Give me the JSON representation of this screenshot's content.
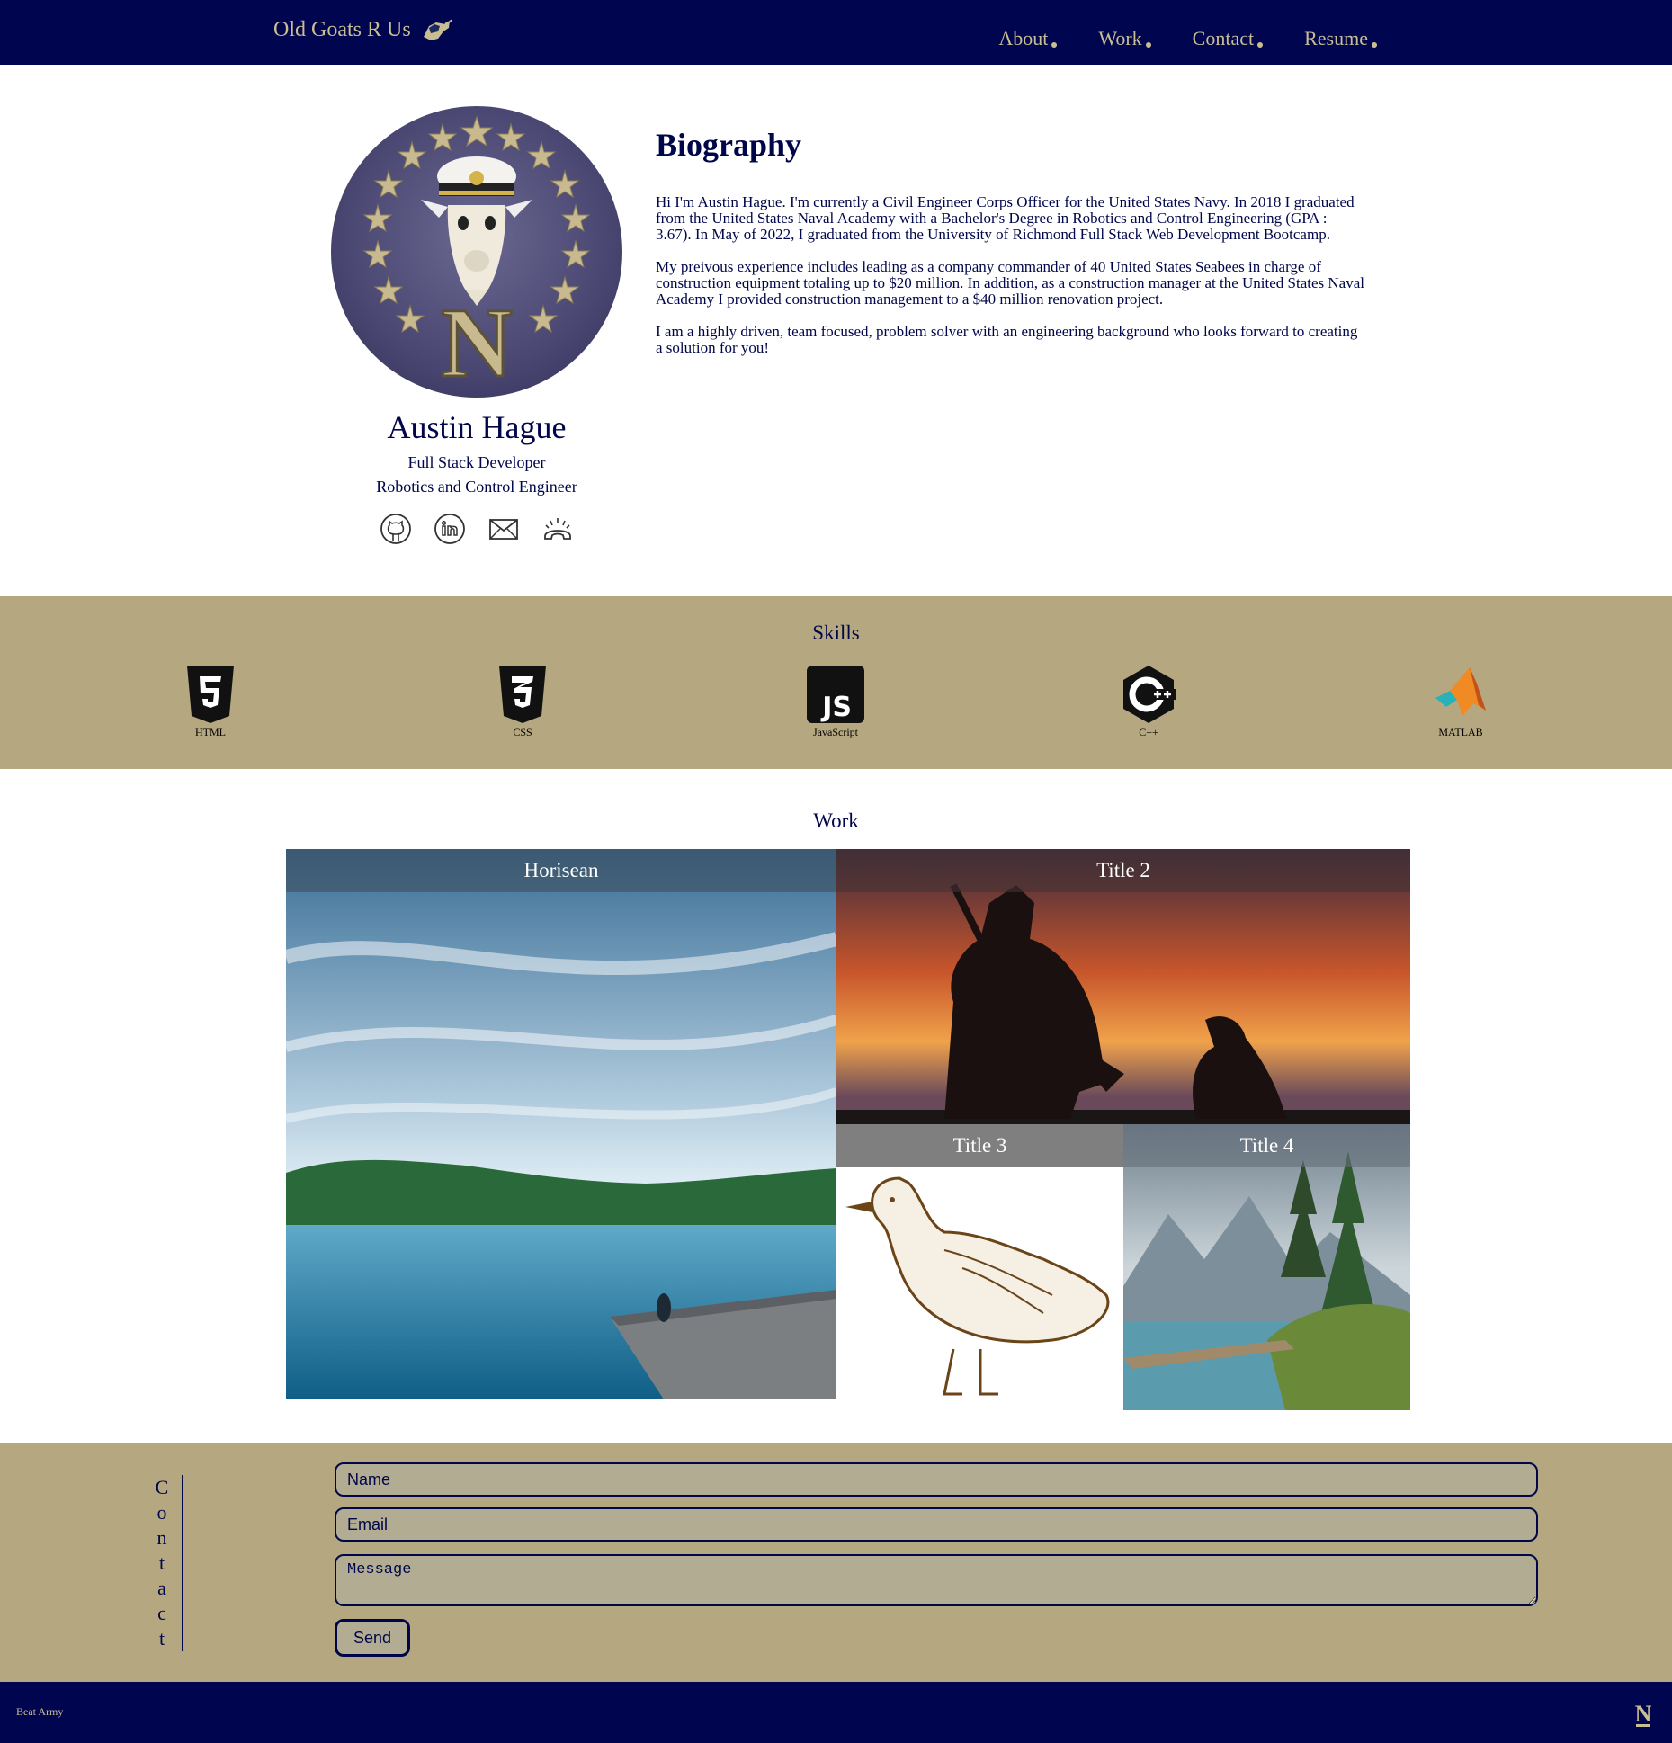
{
  "header": {
    "brand": "Old Goats R Us",
    "nav": [
      {
        "label": "About"
      },
      {
        "label": "Work"
      },
      {
        "label": "Contact"
      },
      {
        "label": "Resume"
      }
    ]
  },
  "profile": {
    "name": "Austin Hague",
    "role": "Full Stack Developer",
    "role2": "Robotics and Control Engineer",
    "socials": [
      "github-icon",
      "linkedin-icon",
      "email-icon",
      "phone-icon"
    ]
  },
  "bio": {
    "title": "Biography",
    "paragraphs": [
      "Hi I'm Austin Hague. I'm currently a Civil Engineer Corps Officer for the United States Navy. In 2018 I graduated from the United States Naval Academy with a Bachelor's Degree in Robotics and Control Engineering (GPA : 3.67). In May of 2022, I graduated from the University of Richmond Full Stack Web Development Bootcamp.",
      "My preivous experience includes leading as a company commander of 40 United States Seabees in charge of construction equipment totaling up to $20 million. In addition, as a construction manager at the United States Naval Academy I provided construction management to a $40 million renovation project.",
      "I am a highly driven, team focused, problem solver with an engineering background who looks forward to creating a solution for you!"
    ]
  },
  "skills": {
    "title": "Skills",
    "items": [
      {
        "label": "HTML",
        "icon": "html5-icon"
      },
      {
        "label": "CSS",
        "icon": "css3-icon"
      },
      {
        "label": "JavaScript",
        "icon": "javascript-icon"
      },
      {
        "label": "C++",
        "icon": "cplusplus-icon"
      },
      {
        "label": "MATLAB",
        "icon": "matlab-icon"
      }
    ]
  },
  "work": {
    "title": "Work",
    "projects": [
      {
        "title": "Horisean"
      },
      {
        "title": "Title 2"
      },
      {
        "title": "Title 3"
      },
      {
        "title": "Title 4"
      }
    ]
  },
  "contact": {
    "vertical_label": [
      "C",
      "o",
      "n",
      "t",
      "a",
      "c",
      "t"
    ],
    "name_placeholder": "Name",
    "email_placeholder": "Email",
    "message_placeholder": "Message",
    "send_label": "Send"
  },
  "footer": {
    "text": "Beat Army"
  },
  "colors": {
    "navy": "#000550",
    "gold": "#b5a77f",
    "gold_text": "#c9bd93"
  }
}
